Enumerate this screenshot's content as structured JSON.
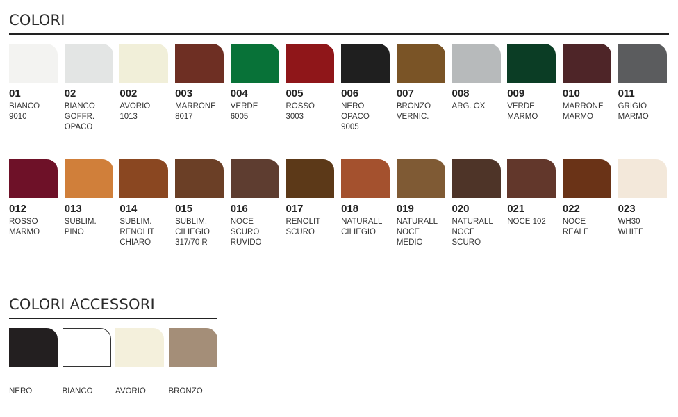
{
  "sections": {
    "colori_title": "COLORI",
    "accessori_title": "COLORI ACCESSORI"
  },
  "colors": [
    {
      "code": "01",
      "name": "BIANCO\n9010",
      "color": "#f3f3f1"
    },
    {
      "code": "02",
      "name": "BIANCO\nGOFFR.\nOPACO",
      "color": "#e3e5e4"
    },
    {
      "code": "002",
      "name": "AVORIO\n1013",
      "color": "#f1efd9"
    },
    {
      "code": "003",
      "name": "MARRONE\n8017",
      "color": "#6e2f23"
    },
    {
      "code": "004",
      "name": "VERDE\n6005",
      "color": "#087238"
    },
    {
      "code": "005",
      "name": "ROSSO\n3003",
      "color": "#8f1619"
    },
    {
      "code": "006",
      "name": "NERO\nOPACO\n9005",
      "color": "#1f1f1f"
    },
    {
      "code": "007",
      "name": "BRONZO\nVERNIC.",
      "color": "#7a5426"
    },
    {
      "code": "008",
      "name": "ARG. OX",
      "color": "#b7babb"
    },
    {
      "code": "009",
      "name": "VERDE\nMARMO",
      "color": "#0b3d25"
    },
    {
      "code": "010",
      "name": "MARRONE\nMARMO",
      "color": "#4e2528"
    },
    {
      "code": "011",
      "name": "GRIGIO\nMARMO",
      "color": "#5b5c5e"
    },
    {
      "code": "012",
      "name": "ROSSO\nMARMO",
      "color": "#6e1128"
    },
    {
      "code": "013",
      "name": "SUBLIM.\nPINO",
      "color": "#d07f3a"
    },
    {
      "code": "014",
      "name": "SUBLIM.\nRENOLIT\nCHIARO",
      "color": "#8a4721"
    },
    {
      "code": "015",
      "name": "SUBLIM.\nCILIEGIO\n317/70 R",
      "color": "#6b3f26"
    },
    {
      "code": "016",
      "name": "NOCE\nSCURO\nRUVIDO",
      "color": "#5e3d30"
    },
    {
      "code": "017",
      "name": "RENOLIT\nSCURO",
      "color": "#5c3918"
    },
    {
      "code": "018",
      "name": "NATURALL\nCILIEGIO",
      "color": "#a4512e"
    },
    {
      "code": "019",
      "name": "NATURALL\nNOCE\nMEDIO",
      "color": "#7f5a34"
    },
    {
      "code": "020",
      "name": "NATURALL\nNOCE\nSCURO",
      "color": "#4e3428"
    },
    {
      "code": "021",
      "name": "NOCE 102",
      "color": "#62372b"
    },
    {
      "code": "022",
      "name": "NOCE\nREALE",
      "color": "#6a3317"
    },
    {
      "code": "023",
      "name": "WH30\nWHITE",
      "color": "#f3e8da"
    }
  ],
  "accessori": [
    {
      "name": "NERO",
      "color": "#231f20",
      "border": "#231f20"
    },
    {
      "name": "BIANCO",
      "color": "#ffffff",
      "border": "#333333"
    },
    {
      "name": "AVORIO",
      "color": "#f4f0dc",
      "border": "#f4f0dc"
    },
    {
      "name": "BRONZO",
      "color": "#a48e78",
      "border": "#a48e78"
    }
  ]
}
